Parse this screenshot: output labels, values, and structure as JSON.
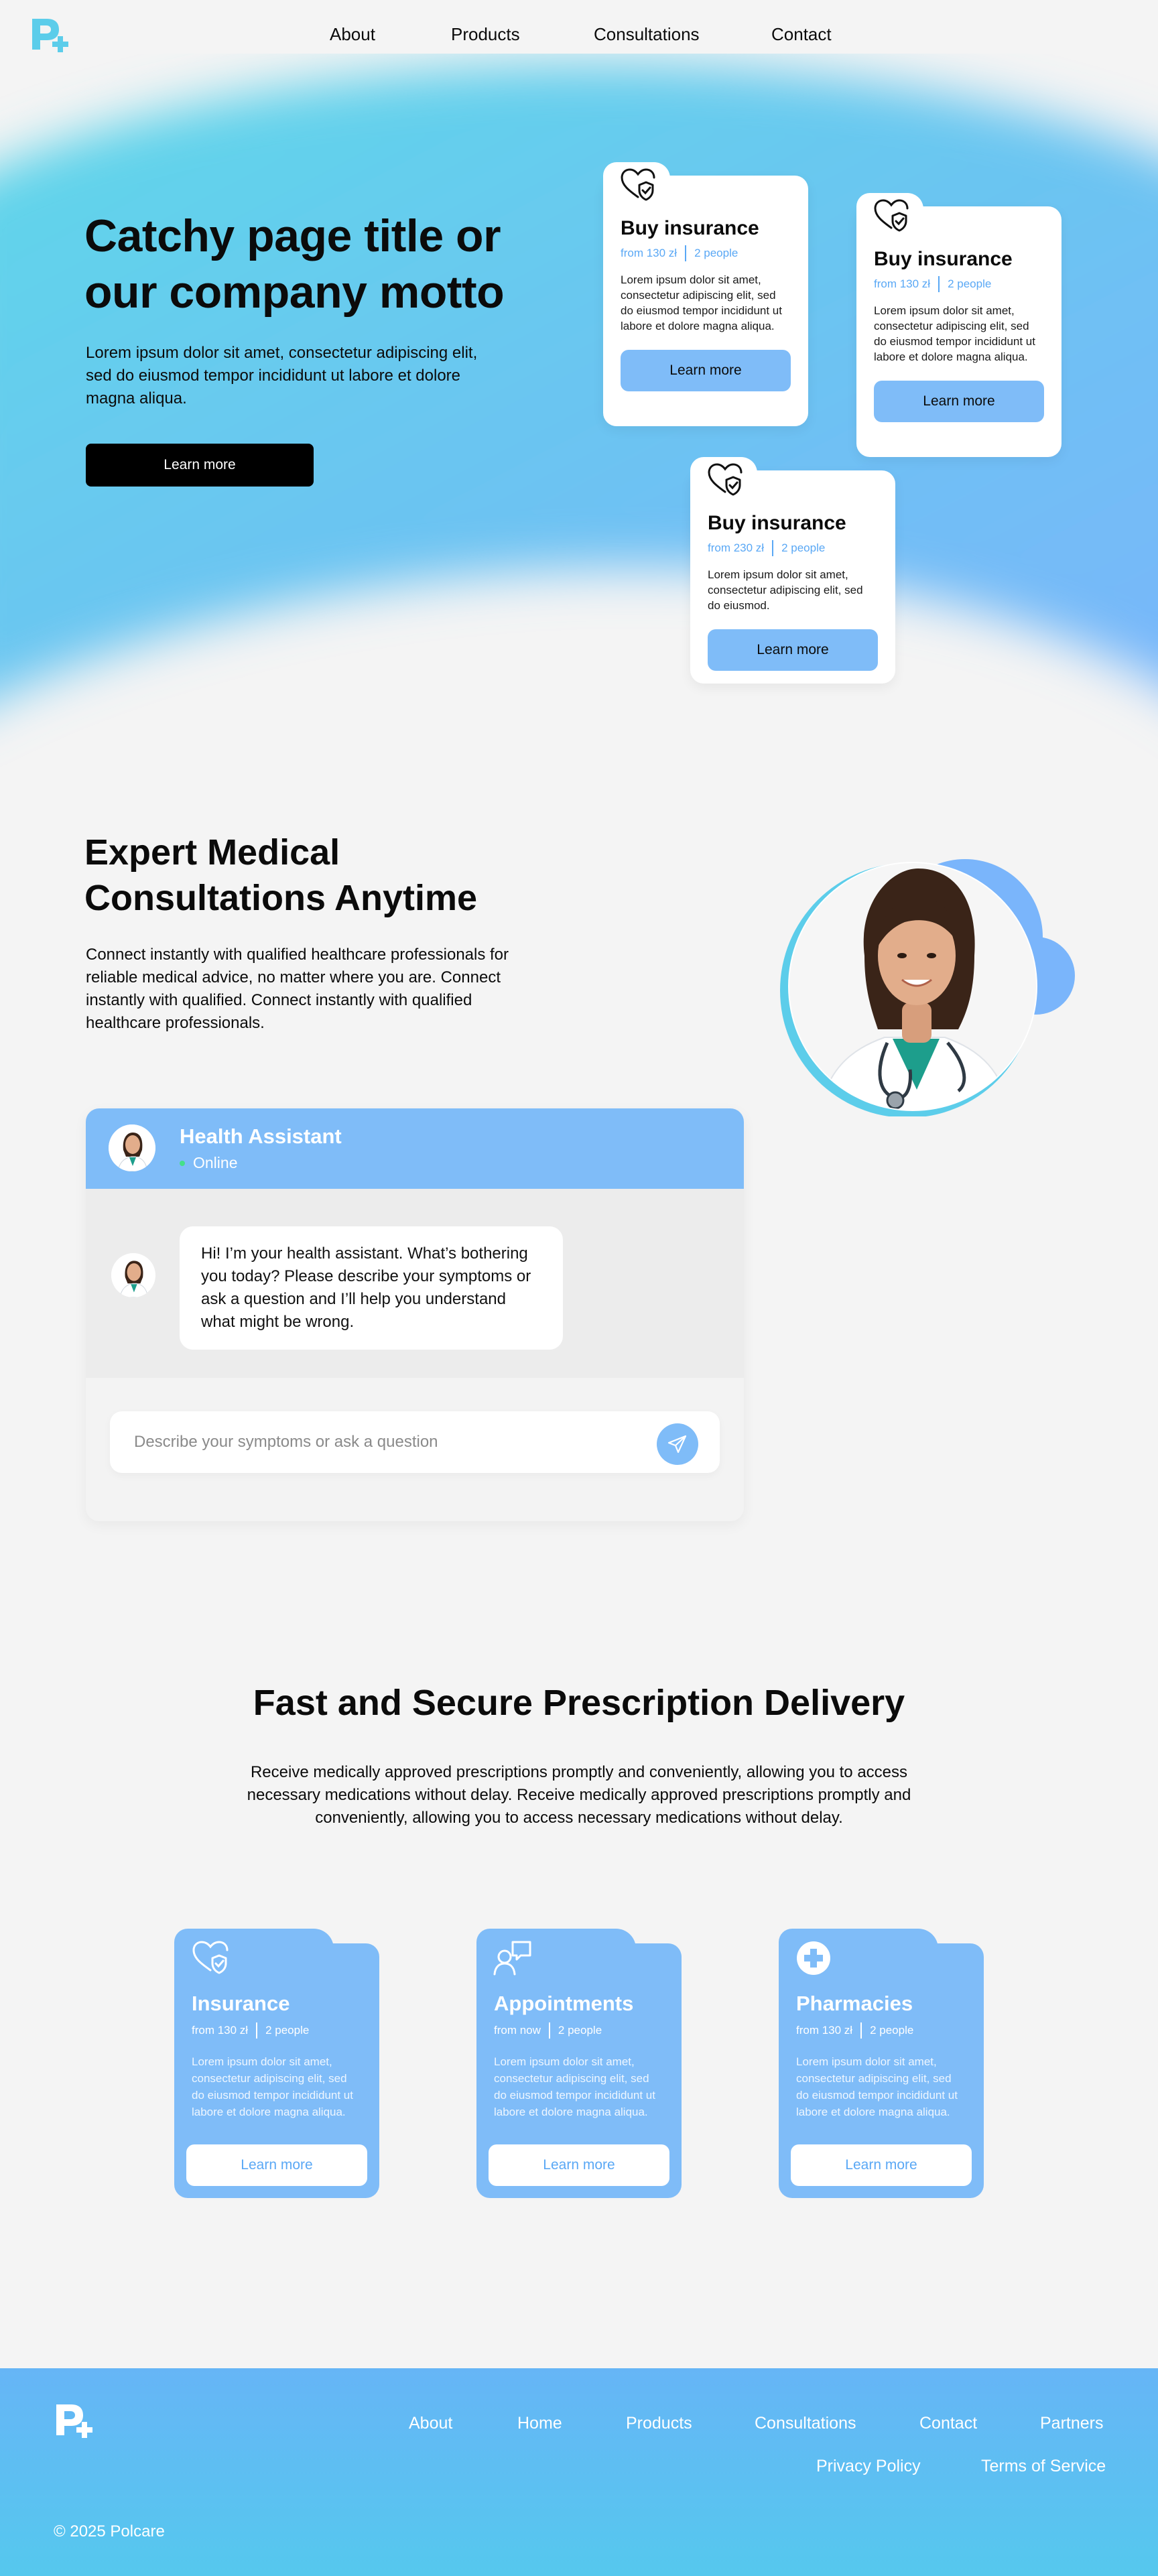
{
  "brand": {
    "logo": "pills-plus-logo",
    "accent": "#7fbcf8",
    "accent_dark": "#5aa8f5",
    "wave": "#5fd4ea"
  },
  "nav": {
    "items": [
      "About",
      "Products",
      "Consultations",
      "Contact"
    ]
  },
  "hero": {
    "title": "Catchy page title or our company motto",
    "subtitle": "Lorem ipsum dolor sit amet, consectetur adipiscing elit, sed do eiusmod tempor incididunt ut labore et dolore magna aliqua.",
    "cta": "Learn more",
    "cards": [
      {
        "icon": "heart-shield-icon",
        "title": "Buy insurance",
        "price": "from 130 zł",
        "people": "2 people",
        "desc": "Lorem ipsum dolor sit amet, consectetur adipiscing elit, sed do eiusmod tempor incididunt ut labore et dolore magna aliqua.",
        "button": "Learn more"
      },
      {
        "icon": "heart-shield-icon",
        "title": "Buy insurance",
        "price": "from 130 zł",
        "people": "2 people",
        "desc": "Lorem ipsum dolor sit amet, consectetur adipiscing elit, sed do eiusmod tempor incididunt ut labore et dolore magna aliqua.",
        "button": "Learn more"
      },
      {
        "icon": "heart-shield-icon",
        "title": "Buy insurance",
        "price": "from 230 zł",
        "people": "2 people",
        "desc": "Lorem ipsum dolor sit amet, consectetur adipiscing elit, sed do eiusmod.",
        "button": "Learn more"
      }
    ]
  },
  "consultations": {
    "title": "Expert Medical Consultations Anytime",
    "subtitle": "Connect instantly with qualified healthcare professionals for reliable medical advice, no matter where you are. Connect instantly with qualified. Connect instantly with qualified healthcare professionals.",
    "chat": {
      "name": "Health Assistant",
      "status": "Online",
      "message": "Hi! I’m your health assistant. What’s bothering you today? Please describe your symptoms or ask a question and I’ll help you understand what might be wrong.",
      "placeholder": "Describe your symptoms or ask a question",
      "send_icon": "paper-plane-icon"
    }
  },
  "delivery": {
    "title": "Fast and Secure Prescription Delivery",
    "subtitle": "Receive medically approved prescriptions promptly and conveniently, allowing you to access necessary medications without delay. Receive medically approved prescriptions promptly and conveniently, allowing you to access necessary medications without delay.",
    "cards": [
      {
        "icon": "heart-shield-icon",
        "title": "Insurance",
        "meta1": "from 130 zł",
        "meta2": "2 people",
        "desc": "Lorem ipsum dolor sit amet, consectetur adipiscing elit, sed do eiusmod tempor incididunt ut labore et dolore magna aliqua.",
        "button": "Learn more"
      },
      {
        "icon": "chat-person-icon",
        "title": "Appointments",
        "meta1": "from now",
        "meta2": "2 people",
        "desc": "Lorem ipsum dolor sit amet, consectetur adipiscing elit, sed do eiusmod tempor incididunt ut labore et dolore magna aliqua.",
        "button": "Learn more"
      },
      {
        "icon": "medical-cross-icon",
        "title": "Pharmacies",
        "meta1": "from 130 zł",
        "meta2": "2 people",
        "desc": "Lorem ipsum dolor sit amet, consectetur adipiscing elit, sed do eiusmod tempor incididunt ut labore et dolore magna aliqua.",
        "button": "Learn more"
      }
    ]
  },
  "footer": {
    "links": [
      "About",
      "Home",
      "Products",
      "Consultations",
      "Contact",
      "Partners"
    ],
    "legal": [
      "Privacy Policy",
      "Terms of Service"
    ],
    "copyright": "© 2025 Polcare"
  }
}
